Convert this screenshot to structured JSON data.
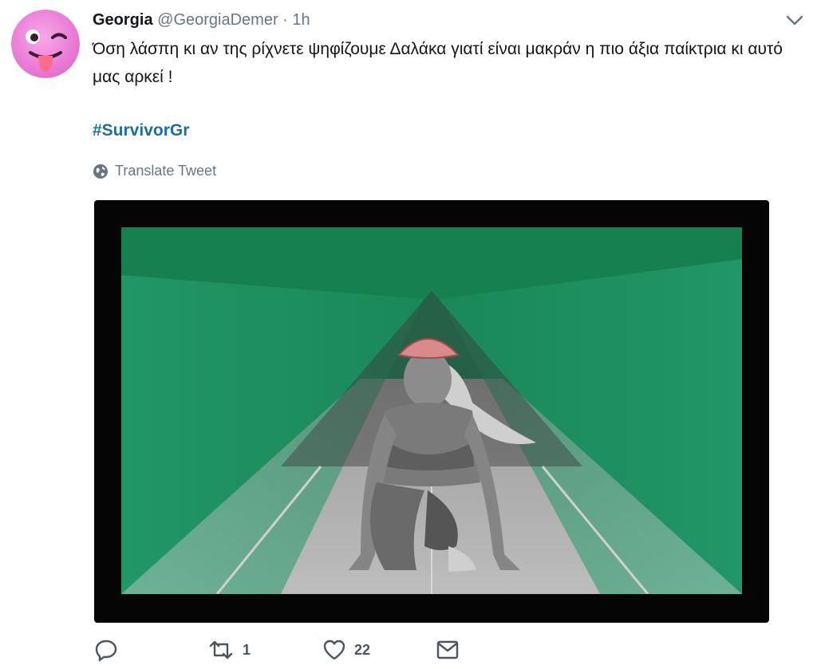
{
  "tweet": {
    "display_name": "Georgia",
    "handle": "@GeorgiaDemer",
    "separator": "·",
    "time": "1h",
    "text": "Όση λάσπη κι αν της ρίχνετε ψηφίζουμε Δαλάκα γιατί είναι μακράν η πιο άξια παίκτρια κι αυτό μας αρκεί !",
    "hashtag": "#SurvivorGr",
    "translate_label": "Translate Tweet"
  },
  "actions": {
    "reply_count": "",
    "retweet_count": "1",
    "like_count": "22"
  },
  "icons": {
    "avatar": "winking-tongue-emoji-icon",
    "caret": "chevron-down-icon",
    "translate": "globe-icon",
    "reply": "reply-icon",
    "retweet": "retweet-icon",
    "like": "heart-icon",
    "message": "direct-message-icon"
  },
  "colors": {
    "name": "#14171a",
    "muted": "#657786",
    "hashtag": "#1b6fa0",
    "avatar": "#f07cd9",
    "photo_tint": "#1aa36a"
  }
}
